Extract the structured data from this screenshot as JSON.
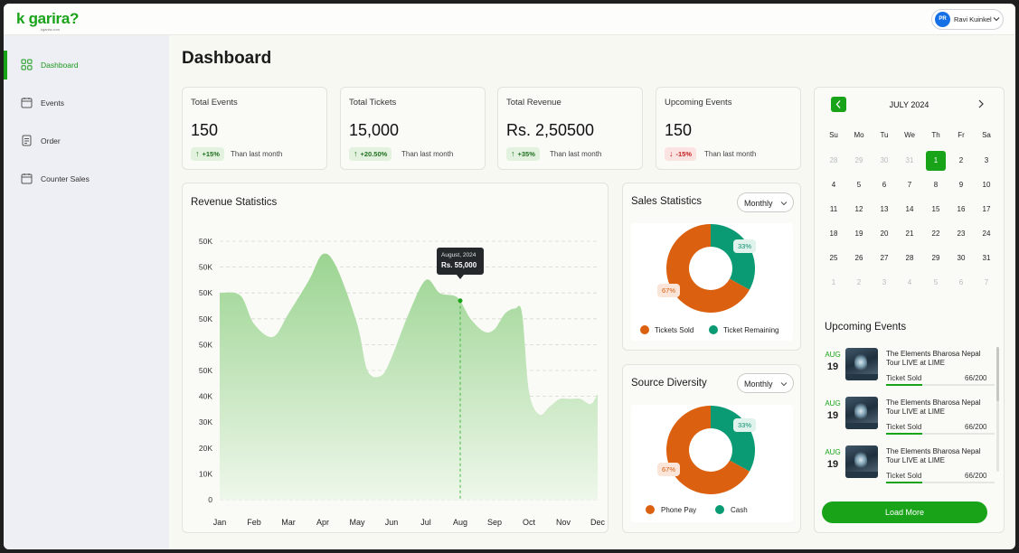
{
  "app": {
    "logo_text": "k garira?",
    "logo_subtext": "kgarira.com"
  },
  "user": {
    "initials": "PR",
    "name": "Ravi Kuinkel"
  },
  "sidebar": {
    "items": [
      {
        "label": "Dashboard",
        "icon": "grid-icon",
        "active": true
      },
      {
        "label": "Events",
        "icon": "calendar-icon",
        "active": false
      },
      {
        "label": "Order",
        "icon": "receipt-icon",
        "active": false
      },
      {
        "label": "Counter Sales",
        "icon": "calendar-icon",
        "active": false
      }
    ]
  },
  "page": {
    "title": "Dashboard"
  },
  "stats": [
    {
      "title": "Total Events",
      "value": "150",
      "change": "+15%",
      "direction": "up",
      "compare": "Than last month"
    },
    {
      "title": "Total Tickets",
      "value": "15,000",
      "change": "+20.50%",
      "direction": "up",
      "compare": "Than last month"
    },
    {
      "title": "Total Revenue",
      "value": "Rs. 2,50500",
      "change": "+35%",
      "direction": "up",
      "compare": "Than last month"
    },
    {
      "title": "Upcoming Events",
      "value": "150",
      "change": "-15%",
      "direction": "down",
      "compare": "Than last month"
    }
  ],
  "revenue": {
    "title": "Revenue Statistics",
    "tooltip": {
      "title": "August, 2024",
      "value": "Rs. 55,000"
    }
  },
  "chart_data": {
    "type": "area",
    "title": "Revenue Statistics",
    "categories": [
      "Jan",
      "Feb",
      "Mar",
      "Apr",
      "May",
      "Jun",
      "Jul",
      "Aug",
      "Sep",
      "Oct",
      "Nov",
      "Dec"
    ],
    "y_ticks": [
      "50K",
      "50K",
      "50K",
      "50K",
      "50K",
      "50K",
      "40K",
      "30K",
      "20K",
      "10K",
      "0"
    ],
    "ylim": [
      0,
      100
    ],
    "x": [
      0,
      0.6,
      1,
      1.55,
      2,
      2.6,
      3,
      3.4,
      4,
      4.3,
      4.7,
      5,
      5.5,
      6,
      6.4,
      6.8,
      7,
      7.3,
      7.7,
      8,
      8.3,
      8.6,
      8.8,
      9,
      9.3,
      9.6,
      9.9,
      10.2,
      10.5,
      10.8,
      11
    ],
    "values": [
      80,
      79,
      68,
      63,
      72,
      85,
      95,
      90,
      68,
      50,
      48,
      55,
      72,
      85,
      80,
      79,
      77,
      70,
      65,
      66,
      72,
      74,
      72,
      42,
      33,
      36,
      39,
      39,
      39,
      37,
      41
    ],
    "highlight": {
      "category": "Aug",
      "label": "August, 2024",
      "value": "Rs. 55,000"
    },
    "grid": true,
    "color": "#a6d99c"
  },
  "sales": {
    "title": "Sales Statistics",
    "period": "Monthly",
    "slices": [
      {
        "label": "Tickets Sold",
        "percent": 67,
        "pct_label": "67%",
        "color": "#db600f"
      },
      {
        "label": "Ticket Remaining",
        "percent": 33,
        "pct_label": "33%",
        "color": "#0a9b74"
      }
    ]
  },
  "source": {
    "title": "Source Diversity",
    "period": "Monthly",
    "slices": [
      {
        "label": "Phone Pay",
        "percent": 67,
        "pct_label": "67%",
        "color": "#db600f"
      },
      {
        "label": "Cash",
        "percent": 33,
        "pct_label": "33%",
        "color": "#0a9b74"
      }
    ]
  },
  "calendar": {
    "month": "JULY 2024",
    "weekdays": [
      "Su",
      "Mo",
      "Tu",
      "We",
      "Th",
      "Fr",
      "Sa"
    ],
    "weeks": [
      [
        "28",
        "29",
        "30",
        "31",
        "1",
        "2",
        "3"
      ],
      [
        "4",
        "5",
        "6",
        "7",
        "8",
        "9",
        "10"
      ],
      [
        "11",
        "12",
        "13",
        "14",
        "15",
        "16",
        "17"
      ],
      [
        "18",
        "19",
        "20",
        "21",
        "22",
        "23",
        "24"
      ],
      [
        "25",
        "26",
        "27",
        "28",
        "29",
        "30",
        "31"
      ],
      [
        "1",
        "2",
        "3",
        "4",
        "5",
        "6",
        "7"
      ]
    ],
    "selected": "1"
  },
  "upcoming": {
    "title": "Upcoming Events",
    "events": [
      {
        "month": "AUG",
        "day": "19",
        "name": "The Elements Bharosa Nepal Tour LIVE at LIME",
        "sold_label": "Ticket Sold",
        "sold": "66/200",
        "progress": 0.33
      },
      {
        "month": "AUG",
        "day": "19",
        "name": "The Elements Bharosa Nepal Tour LIVE at LIME",
        "sold_label": "Ticket Sold",
        "sold": "66/200",
        "progress": 0.33
      },
      {
        "month": "AUG",
        "day": "19",
        "name": "The Elements Bharosa Nepal Tour LIVE at LIME",
        "sold_label": "Ticket Sold",
        "sold": "66/200",
        "progress": 0.33
      }
    ],
    "load_more": "Load More"
  }
}
